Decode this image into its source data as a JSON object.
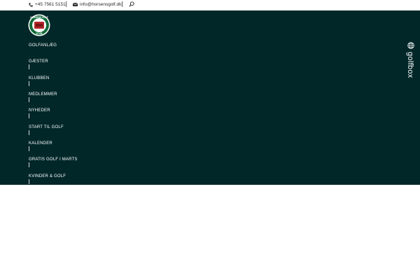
{
  "topbar": {
    "phone": "+45 7561 5151",
    "email": "info@horsensgolf.dk"
  },
  "logo": {
    "text_top": "HORSENS GOLF",
    "text_bottom": "KLUB"
  },
  "nav": {
    "items": [
      {
        "label": "GOLFANLÆG"
      },
      {
        "label": "GÆSTER"
      },
      {
        "label": "KLUBBEN"
      },
      {
        "label": "MEDLEMMER"
      },
      {
        "label": "NYHEDER"
      },
      {
        "label": "START TIL GOLF"
      },
      {
        "label": "KALENDER"
      },
      {
        "label": "GRATIS GOLF I MARTS"
      },
      {
        "label": "KVINDER & GOLF"
      }
    ]
  },
  "golfbox": {
    "label": "golfbox"
  },
  "colors": {
    "header_bg": "#012729",
    "logo_green": "#0f6b3a",
    "logo_red": "#b3262a"
  }
}
